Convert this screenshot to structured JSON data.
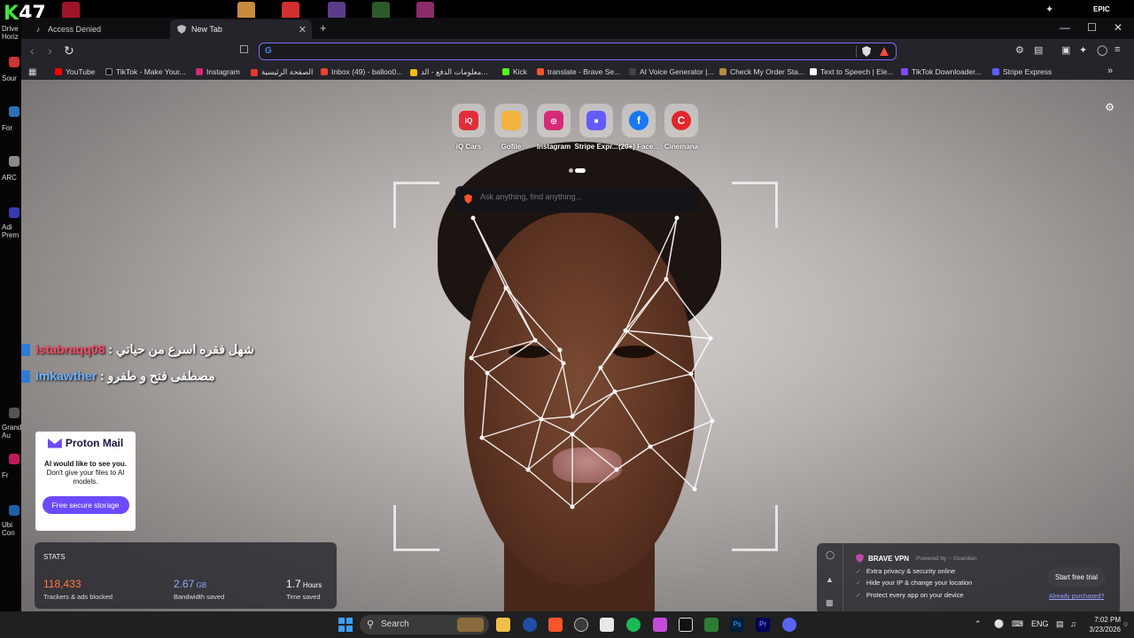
{
  "desktop": {
    "overlay_logo": {
      "k": "K",
      "num": "47"
    },
    "top_label": "EPIC",
    "left_icons": [
      "Drive Horiz",
      "Sour",
      "For",
      "ARC",
      "Adi Prem",
      "Grand Au",
      "Fr",
      "Ubi Con"
    ]
  },
  "browser": {
    "tabs": [
      {
        "label": "Access Denied",
        "active": false
      },
      {
        "label": "New Tab",
        "active": true
      }
    ],
    "new_tab_symbol": "+",
    "window_controls": {
      "minimize": "—",
      "maximize": "☐",
      "close": "✕"
    },
    "nav": {
      "back": "‹",
      "forward": "›",
      "reload": "↻"
    },
    "url": {
      "value": "",
      "placeholder": ""
    },
    "bookmarks": [
      {
        "label": "YouTube",
        "color": "#ff0000"
      },
      {
        "label": "TikTok - Make Your...",
        "color": "#111111"
      },
      {
        "label": "Instagram",
        "color": "#d62976"
      },
      {
        "label": "الصفحة الرئيسية",
        "color": "#e53935"
      },
      {
        "label": "Inbox (49) - balloo0...",
        "color": "#ea4335"
      },
      {
        "label": "معلومات الدفع - الد...",
        "color": "#fbbc05"
      },
      {
        "label": "Kick",
        "color": "#53fc18"
      },
      {
        "label": "translate - Brave Se...",
        "color": "#fb542b"
      },
      {
        "label": "AI Voice Generator |...",
        "color": "#444444"
      },
      {
        "label": "Check My Order Sta...",
        "color": "#b58b3c"
      },
      {
        "label": "Text to Speech | Ele...",
        "color": "#ffffff"
      },
      {
        "label": "TikTok Downloader...",
        "color": "#7c4dff"
      },
      {
        "label": "Stripe Express",
        "color": "#635bff"
      }
    ],
    "bookmarks_overflow": "»"
  },
  "ntp": {
    "top_sites": [
      {
        "label": "iQ Cars",
        "short": "iQ",
        "color": "#e12d39"
      },
      {
        "label": "Gofile",
        "short": "",
        "color": "#f3b33d"
      },
      {
        "label": "Instagram",
        "short": "◎",
        "color": "#d62976"
      },
      {
        "label": "Stripe Expr...",
        "short": "■",
        "color": "#635bff"
      },
      {
        "label": "(20+) Face...",
        "short": "f",
        "color": "#1877f2"
      },
      {
        "label": "Cinemana",
        "short": "C",
        "color": "#e3262b"
      }
    ],
    "search": {
      "placeholder": "Ask anything, find anything..."
    },
    "chat": [
      {
        "user": "istabraqq08",
        "message": "شهل فقره اسرع من حياتي"
      },
      {
        "user": "imkawther",
        "message": "مصطفى فتح و طفرو"
      }
    ],
    "proton": {
      "brand": "Proton Mail",
      "headline": "AI would like to see you.",
      "body": "Don't give your files to AI models.",
      "cta": "Free secure storage"
    },
    "stats": {
      "title": "STATS",
      "trackers": {
        "value": "118,433",
        "label": "Trackers & ads blocked",
        "color": "#ff7a45"
      },
      "bandwidth": {
        "value": "2.67",
        "unit": "GB",
        "label": "Bandwidth saved",
        "color": "#8fa8ff"
      },
      "time": {
        "value": "1.7",
        "unit": "Hours",
        "label": "Time saved",
        "color": "#ffffff"
      }
    },
    "vpn": {
      "title": "BRAVE VPN",
      "powered": "Powered by ○ Guardian",
      "features": [
        "Extra privacy & security online",
        "Hide your IP & change your location",
        "Protect every app on your device"
      ],
      "cta": "Start free trial",
      "link": "Already purchased?"
    }
  },
  "taskbar": {
    "search_label": "Search",
    "lang": "ENG",
    "time": "7:02 PM",
    "date": "3/23/2026"
  }
}
